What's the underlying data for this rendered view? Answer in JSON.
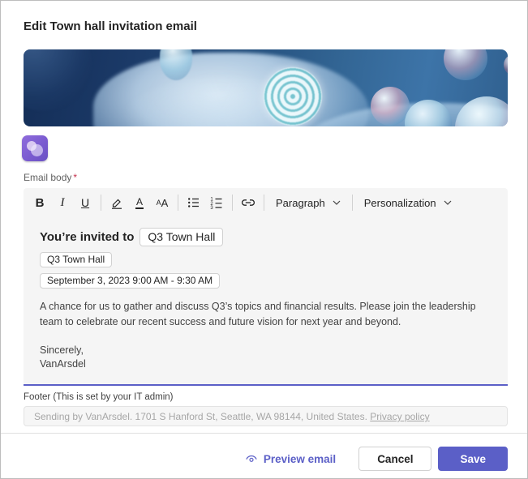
{
  "dialog": {
    "title": "Edit Town hall invitation email"
  },
  "email_body_field": {
    "label": "Email body",
    "required_marker": "*"
  },
  "toolbar": {
    "bold": "B",
    "italic": "I",
    "underline": "U",
    "font_color": "A",
    "font_size_small": "A",
    "font_size_large": "A",
    "paragraph": "Paragraph",
    "personalization": "Personalization"
  },
  "email_content": {
    "heading": "You’re invited to",
    "heading_chip": "Q3 Town Hall",
    "event_chip": "Q3 Town Hall",
    "datetime_chip": "September 3, 2023 9:00 AM - 9:30 AM",
    "paragraph": "A chance for us to gather and discuss Q3’s topics and financial results. Please join the leadership team to celebrate our recent success and future vision for next year and beyond.",
    "signoff": "Sincerely,",
    "signature": "VanArsdel"
  },
  "footer": {
    "label": "Footer (This is set by your IT admin)",
    "text": "Sending by VanArsdel. 1701 S Hanford St, Seattle, WA 98144, United States.",
    "privacy_link": "Privacy policy"
  },
  "actions": {
    "preview": "Preview email",
    "cancel": "Cancel",
    "save": "Save"
  },
  "colors": {
    "accent": "#5b5fc7",
    "required_marker": "#c4314b",
    "editor_background": "#f5f5f5",
    "disabled_text": "#a6a6a6"
  }
}
